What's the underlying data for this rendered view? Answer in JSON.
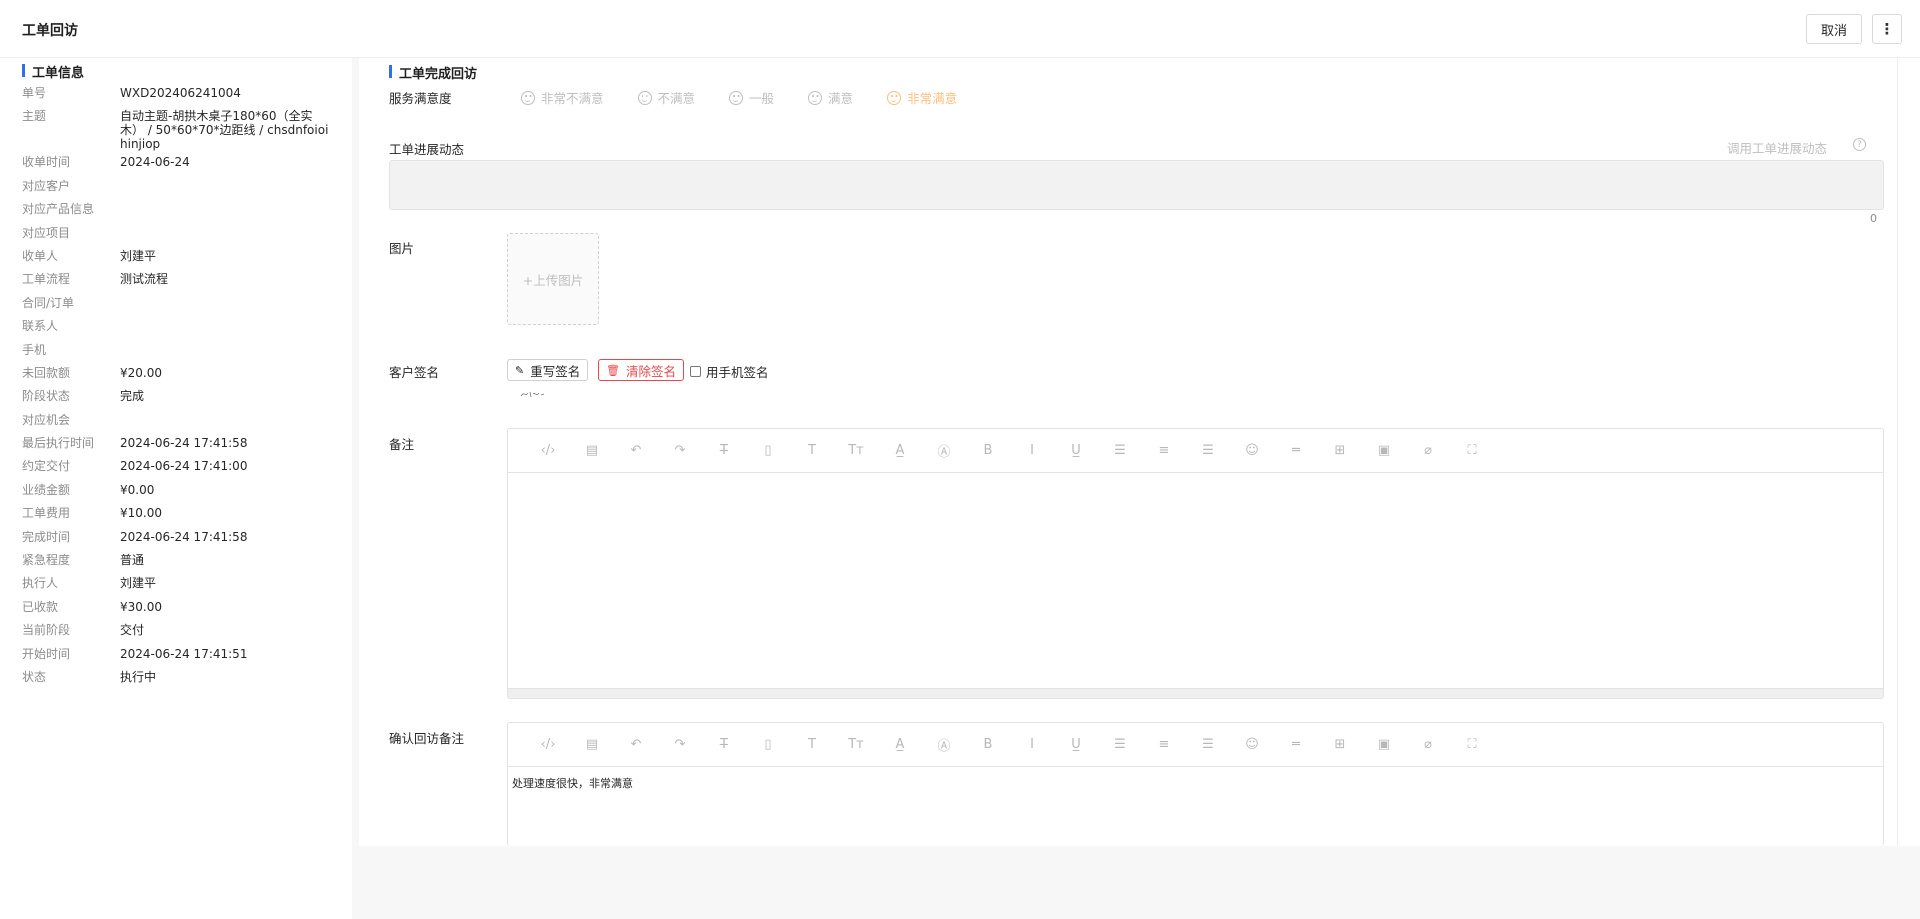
{
  "header": {
    "title": "工单回访",
    "cancel_label": "取消",
    "more_icon": "⋮"
  },
  "left": {
    "section_title": "工单信息",
    "fields": [
      {
        "label": "单号",
        "value": "WXD202406241004"
      },
      {
        "label": "主题",
        "value": "自动主题-胡拱木桌子180*60（全实木） / 50*60*70*边距线 / chsdnfoioihinjiop"
      },
      {
        "label": "收单时间",
        "value": "2024-06-24"
      },
      {
        "label": "对应客户",
        "value": ""
      },
      {
        "label": "对应产品信息",
        "value": ""
      },
      {
        "label": "对应项目",
        "value": ""
      },
      {
        "label": "收单人",
        "value": "刘建平"
      },
      {
        "label": "工单流程",
        "value": "测试流程"
      },
      {
        "label": "合同/订单",
        "value": ""
      },
      {
        "label": "联系人",
        "value": ""
      },
      {
        "label": "手机",
        "value": ""
      },
      {
        "label": "未回款额",
        "value": "¥20.00"
      },
      {
        "label": "阶段状态",
        "value": "完成"
      },
      {
        "label": "对应机会",
        "value": ""
      },
      {
        "label": "最后执行时间",
        "value": "2024-06-24 17:41:58"
      },
      {
        "label": "约定交付",
        "value": "2024-06-24 17:41:00"
      },
      {
        "label": "业绩金额",
        "value": "¥0.00"
      },
      {
        "label": "工单费用",
        "value": "¥10.00"
      },
      {
        "label": "完成时间",
        "value": "2024-06-24 17:41:58"
      },
      {
        "label": "紧急程度",
        "value": "普通"
      },
      {
        "label": "执行人",
        "value": "刘建平"
      },
      {
        "label": "已收款",
        "value": "¥30.00"
      },
      {
        "label": "当前阶段",
        "value": "交付"
      },
      {
        "label": "开始时间",
        "value": "2024-06-24 17:41:51"
      },
      {
        "label": "状态",
        "value": "执行中"
      }
    ]
  },
  "main": {
    "section_title": "工单完成回访",
    "satisfaction": {
      "label": "服务满意度",
      "options": [
        "非常不满意",
        "不满意",
        "一般",
        "满意",
        "非常满意"
      ],
      "selected": "非常满意",
      "accent_color": "#fa8c16"
    },
    "progress": {
      "label": "工单进展动态",
      "link": "调用工单进展动态",
      "help_icon": "?",
      "count": "0"
    },
    "image": {
      "label": "图片",
      "upload_label": "+上传图片"
    },
    "signature": {
      "label": "客户签名",
      "rewrite_label": "重写签名",
      "clear_label": "清除签名",
      "phone_label": "用手机签名"
    },
    "remark": {
      "label": "备注",
      "content": ""
    },
    "confirm_remark": {
      "label": "确认回访备注",
      "content": "处理速度很快，非常满意"
    },
    "toolbar_icons": [
      "code-icon",
      "template-icon",
      "undo-icon",
      "redo-icon",
      "strikethrough-icon",
      "clear-format-icon",
      "text-size-icon",
      "font-size-icon",
      "font-color-icon",
      "background-color-icon",
      "bold-icon",
      "italic-icon",
      "underline-icon",
      "align-left-icon",
      "align-center-icon",
      "align-right-icon",
      "emoji-icon",
      "divider-icon",
      "table-icon",
      "image-icon",
      "attachment-icon",
      "fullscreen-icon"
    ]
  },
  "colors": {
    "accent": "#2f6fed",
    "danger": "#e5484d"
  }
}
